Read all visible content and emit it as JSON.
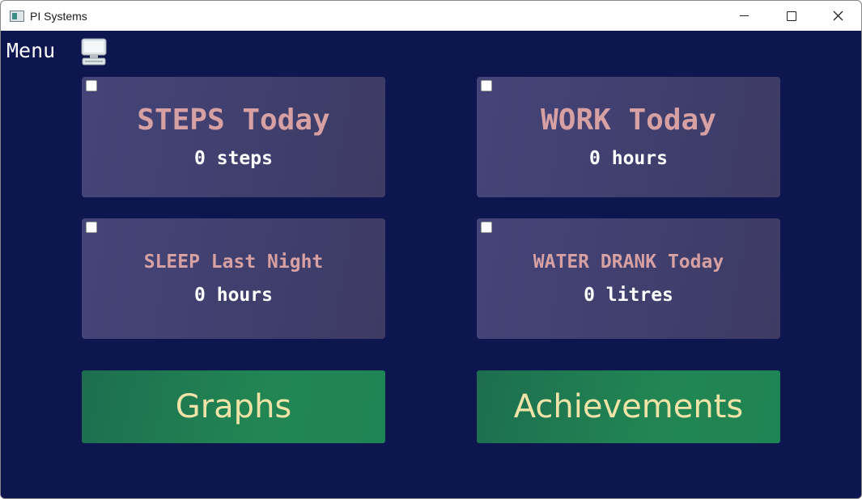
{
  "window": {
    "title": "PI Systems",
    "controls": [
      "minimize",
      "maximize",
      "close"
    ]
  },
  "menu": {
    "label": "Menu",
    "icon": "computer-icon"
  },
  "cards": {
    "steps": {
      "title": "STEPS Today",
      "value": "0 steps",
      "checked": false
    },
    "work": {
      "title": "WORK Today",
      "value": "0 hours",
      "checked": false
    },
    "sleep": {
      "title": "SLEEP Last Night",
      "value": "0 hours",
      "checked": false
    },
    "water": {
      "title": "WATER DRANK Today",
      "value": "0 litres",
      "checked": false
    }
  },
  "buttons": {
    "graphs": "Graphs",
    "achievements": "Achievements"
  },
  "colors": {
    "background": "#0e1650",
    "card": "#423f6f",
    "card_title": "#d7a0a2",
    "button": "#208050",
    "button_text": "#efe3a8"
  }
}
